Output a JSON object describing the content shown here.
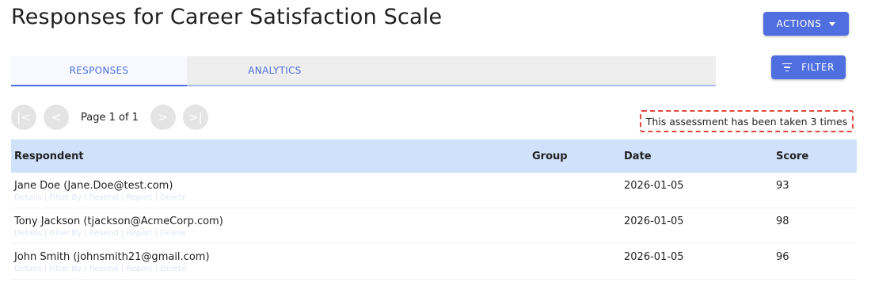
{
  "page": {
    "title": "Responses for Career Satisfaction Scale"
  },
  "actions_button": {
    "label": "ACTIONS"
  },
  "filter_button": {
    "label": "FILTER"
  },
  "tabs": [
    {
      "label": "RESPONSES",
      "active": true
    },
    {
      "label": "ANALYTICS",
      "active": false
    }
  ],
  "pager": {
    "first": "|<",
    "prev": "<",
    "next": ">",
    "last": ">|",
    "label": "Page 1 of 1"
  },
  "notice": "This assessment has been taken 3 times",
  "table": {
    "headers": {
      "respondent": "Respondent",
      "group": "Group",
      "date": "Date",
      "score": "Score"
    },
    "rows": [
      {
        "respondent": "Jane Doe (Jane.Doe@test.com)",
        "group": "",
        "date": "2026-01-05",
        "score": "93",
        "links": "Details | Filter By | Resend | Report | Delete"
      },
      {
        "respondent": "Tony Jackson (tjackson@AcmeCorp.com)",
        "group": "",
        "date": "2026-01-05",
        "score": "98",
        "links": "Details | Filter By | Resend | Report | Delete"
      },
      {
        "respondent": "John Smith (johnsmith21@gmail.com)",
        "group": "",
        "date": "2026-01-05",
        "score": "96",
        "links": "Details | Filter By | Resend | Report | Delete"
      }
    ]
  },
  "colors": {
    "accent": "#4f6fe0",
    "header_bg": "#cfe1fb",
    "notice_border": "#e0463a"
  }
}
